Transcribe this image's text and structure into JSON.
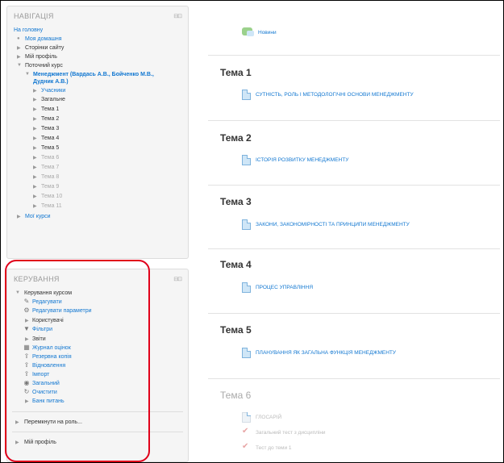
{
  "navigation": {
    "title": "НАВІГАЦІЯ",
    "controls": "⊟⊡",
    "home": "На головну",
    "items": [
      {
        "label": "Моя домашня"
      },
      {
        "label": "Сторінки сайту"
      },
      {
        "label": "Мій профіль"
      },
      {
        "label": "Поточний курс"
      }
    ],
    "course": {
      "line1": "Менеджмент (Вардась А.В., Бойченко М.В.,",
      "line2": "Дудник А.В.)",
      "children": [
        {
          "label": "Учасники"
        },
        {
          "label": "Загальне"
        },
        {
          "label": "Тема 1"
        },
        {
          "label": "Тема 2"
        },
        {
          "label": "Тема 3"
        },
        {
          "label": "Тема 4"
        },
        {
          "label": "Тема 5"
        },
        {
          "label": "Тема 6"
        },
        {
          "label": "Тема 7"
        },
        {
          "label": "Тема 8"
        },
        {
          "label": "Тема 9"
        },
        {
          "label": "Тема 10"
        },
        {
          "label": "Тема 11"
        }
      ]
    },
    "my_courses": "Мої курси"
  },
  "admin": {
    "title": "КЕРУВАННЯ",
    "controls": "⊟⊡",
    "course_admin": "Керування курсом",
    "items": [
      {
        "label": "Редагувати",
        "icon": "pencil-icon"
      },
      {
        "label": "Редагувати параметри",
        "icon": "gear-icon"
      },
      {
        "label": "Користувачі",
        "icon": "arrow"
      },
      {
        "label": "Фільтри",
        "icon": "filter-icon"
      },
      {
        "label": "Звіти",
        "icon": "arrow"
      },
      {
        "label": "Журнал оцінок",
        "icon": "table-icon"
      },
      {
        "label": "Резервна копія",
        "icon": "upload-icon"
      },
      {
        "label": "Відновлення",
        "icon": "upload-icon"
      },
      {
        "label": "Імпорт",
        "icon": "upload-icon"
      },
      {
        "label": "Загальний",
        "icon": "globe-icon"
      },
      {
        "label": "Очистити",
        "icon": "refresh-icon"
      },
      {
        "label": "Банк питань",
        "icon": "arrow"
      }
    ],
    "switch_role": "Перемкнути на роль...",
    "my_profile": "Мій профіль"
  },
  "main": {
    "news": "Новини",
    "sections": [
      {
        "title": "Тема 1",
        "resources": [
          {
            "label": "СУТНІСТЬ, РОЛЬ І МЕТОДОЛОГІЧНІ ОСНОВИ МЕНЕДЖМЕНТУ"
          }
        ]
      },
      {
        "title": "Тема 2",
        "resources": [
          {
            "label": "ІСТОРІЯ РОЗВИТКУ МЕНЕДЖМЕНТУ"
          }
        ]
      },
      {
        "title": "Тема 3",
        "resources": [
          {
            "label": "ЗАКОНИ, ЗАКОНОМІРНОСТІ ТА ПРИНЦИПИ МЕНЕДЖМЕНТУ"
          }
        ]
      },
      {
        "title": "Тема 4",
        "resources": [
          {
            "label": "ПРОЦЕС УПРАВЛІННЯ"
          }
        ]
      },
      {
        "title": "Тема 5",
        "resources": [
          {
            "label": "ПЛАНУВАННЯ ЯК ЗАГАЛЬНА ФУНКЦІЯ МЕНЕДЖМЕНТУ"
          }
        ]
      },
      {
        "title": "Тема 6",
        "resources": [
          {
            "label": "ГЛОСАРІЙ"
          },
          {
            "label": "Загальний тест з дисципліни"
          },
          {
            "label": "Тест до теми 1"
          }
        ]
      }
    ]
  },
  "colors": {
    "link": "#1177d1",
    "highlight": "#e0001a",
    "muted": "#aaaaaa"
  }
}
